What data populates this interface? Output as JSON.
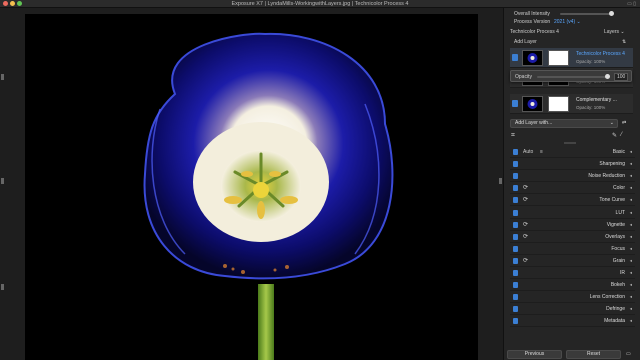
{
  "window": {
    "title": "Exposure X7 | LyndaMills-WorkingwithLayers.jpg | Technicolor Process 4"
  },
  "panel": {
    "overall_intensity_label": "Overall Intensity",
    "overall_intensity_value": 1.0,
    "process_version_label": "Process Version",
    "process_version_value": "2021 (v4)",
    "preset_name": "Technicolor Process 4",
    "layers_menu": "Layers",
    "add_layer": "Add Layer",
    "opacity_popup_label": "Opacity",
    "opacity_popup_value": "100",
    "layers": [
      {
        "name": "Technicolor Process 4",
        "opacity": "Opacity: 100%"
      },
      {
        "name": "",
        "opacity": "Opacity: 100%"
      },
      {
        "name": "Complementary ...",
        "opacity": "Opacity: 100%"
      }
    ],
    "add_layer_with": "Add Layer with...",
    "sections": [
      {
        "label": "Basic",
        "auto": "Auto",
        "cycle": false
      },
      {
        "label": "Sharpening",
        "cycle": false
      },
      {
        "label": "Noise Reduction",
        "cycle": false
      },
      {
        "label": "Color",
        "cycle": true
      },
      {
        "label": "Tone Curve",
        "cycle": true
      },
      {
        "label": "LUT",
        "cycle": false
      },
      {
        "label": "Vignette",
        "cycle": true
      },
      {
        "label": "Overlays",
        "cycle": true
      },
      {
        "label": "Focus",
        "cycle": false
      },
      {
        "label": "Grain",
        "cycle": true
      },
      {
        "label": "IR",
        "cycle": false
      },
      {
        "label": "Bokeh",
        "cycle": false
      },
      {
        "label": "Lens Correction",
        "cycle": false
      },
      {
        "label": "Defringe",
        "cycle": false
      },
      {
        "label": "Metadata",
        "cycle": false
      }
    ],
    "previous_button": "Previous",
    "reset_button": "Reset"
  },
  "colors": {
    "accent": "#3b7fd4",
    "preset_blue": "#5aa7ff"
  },
  "icons": [
    "crop-icon",
    "brush-icon",
    "eyedropper-icon",
    "eye-icon",
    "cycle-icon",
    "chevron-down-icon"
  ]
}
